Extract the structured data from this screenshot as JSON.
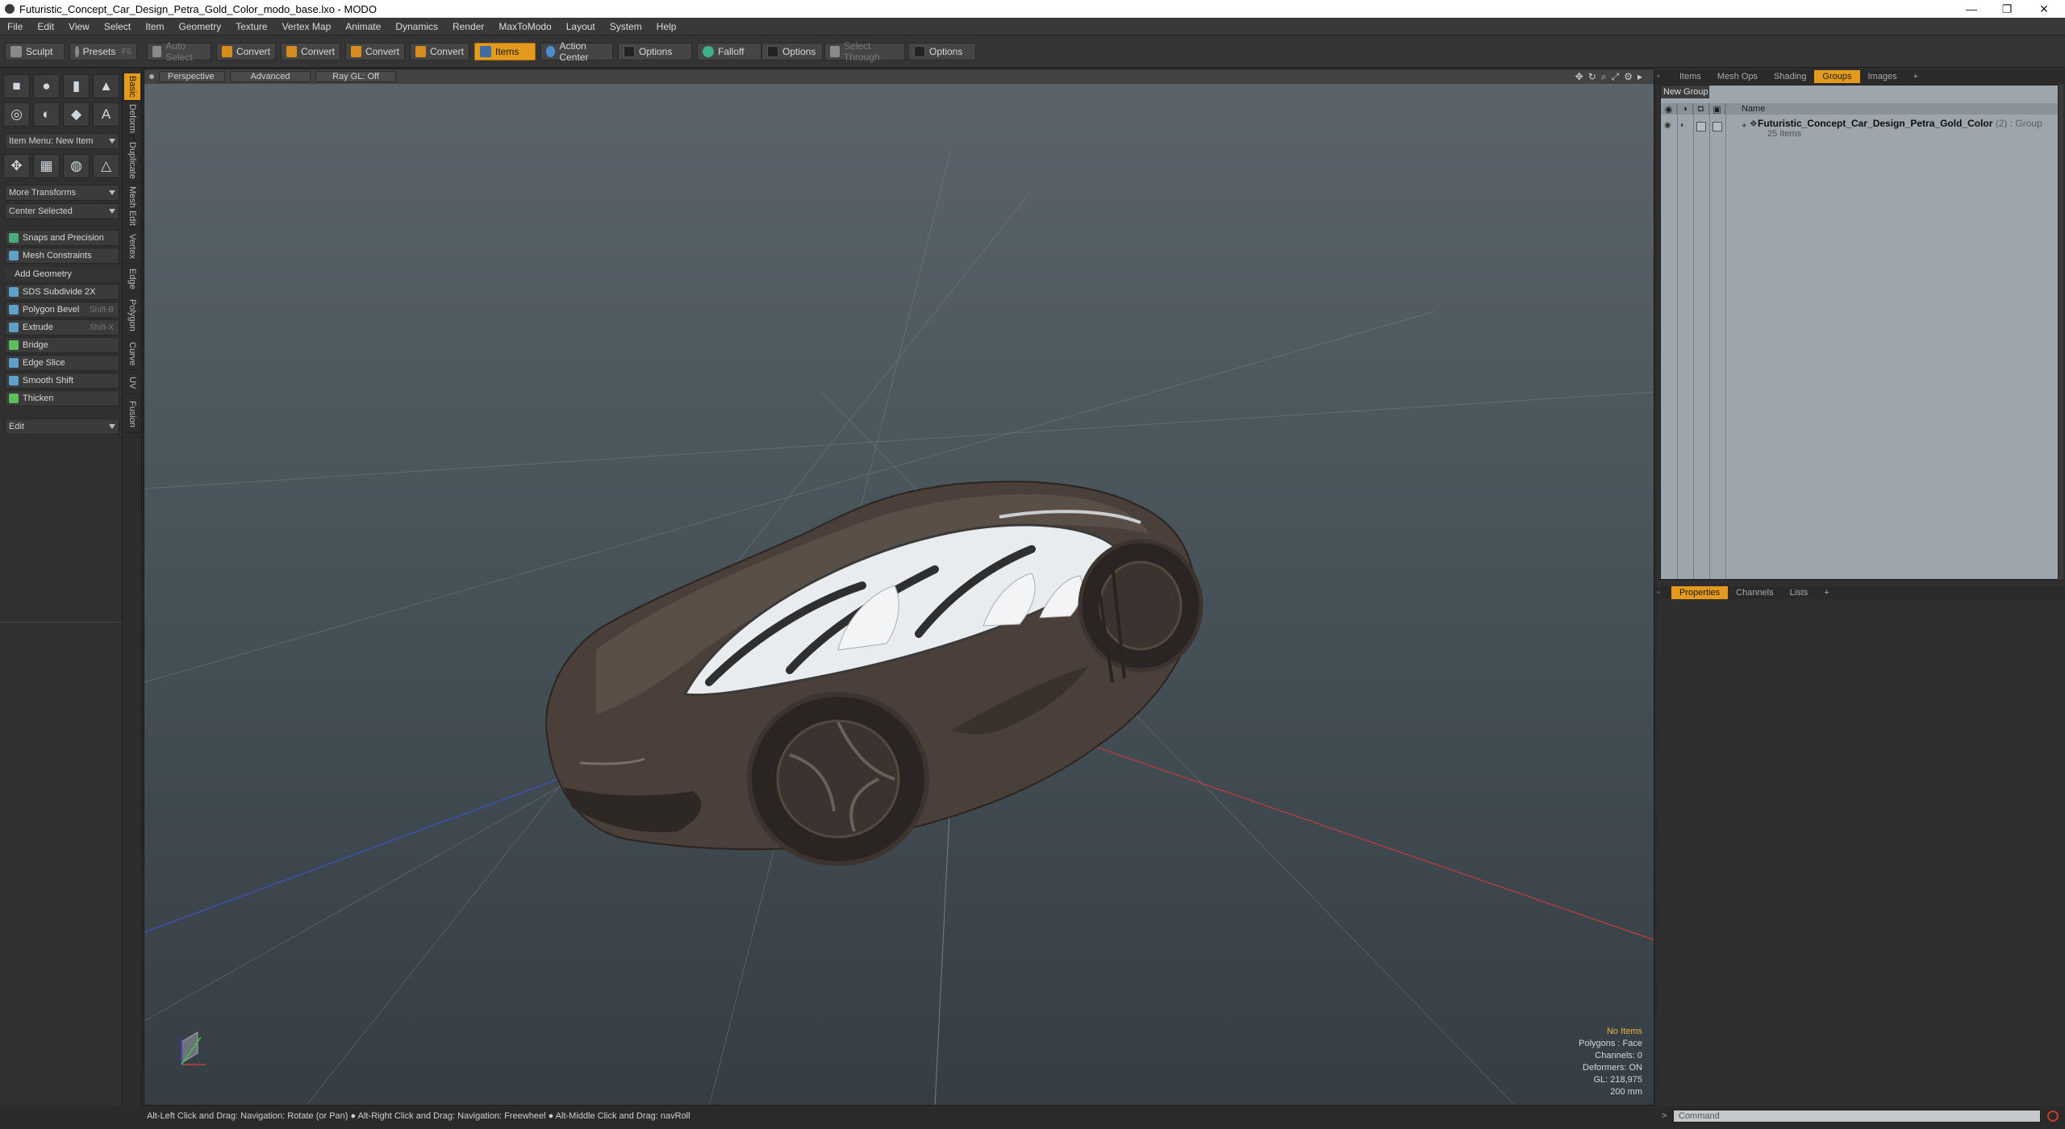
{
  "window": {
    "title": "Futuristic_Concept_Car_Design_Petra_Gold_Color_modo_base.lxo - MODO",
    "controls": [
      "—",
      "❐",
      "✕"
    ]
  },
  "menu": [
    "File",
    "Edit",
    "View",
    "Select",
    "Item",
    "Geometry",
    "Texture",
    "Vertex Map",
    "Animate",
    "Dynamics",
    "Render",
    "MaxToModo",
    "Layout",
    "System",
    "Help"
  ],
  "toolbar": {
    "sculpt": "Sculpt",
    "presets": "Presets",
    "presets_key": "F6",
    "auto_select": "Auto Select",
    "convert1": "Convert",
    "convert2": "Convert",
    "convert3": "Convert",
    "convert4": "Convert",
    "items": "Items",
    "action_center": "Action Center",
    "options1": "Options",
    "falloff": "Falloff",
    "options2": "Options",
    "select_through": "Select Through",
    "options3": "Options"
  },
  "left": {
    "item_menu": "Item Menu: New Item",
    "more_transforms": "More Transforms",
    "center_selected": "Center Selected",
    "snaps": "Snaps and Precision",
    "mesh_constraints": "Mesh Constraints",
    "add_geometry": "Add Geometry",
    "tools": [
      {
        "label": "SDS Subdivide 2X",
        "key": ""
      },
      {
        "label": "Polygon Bevel",
        "key": "Shift-B"
      },
      {
        "label": "Extrude",
        "key": "Shift-X"
      },
      {
        "label": "Bridge",
        "key": ""
      },
      {
        "label": "Edge Slice",
        "key": ""
      },
      {
        "label": "Smooth Shift",
        "key": ""
      },
      {
        "label": "Thicken",
        "key": ""
      }
    ],
    "edit": "Edit",
    "vtabs": [
      "Basic",
      "Deform",
      "Duplicate",
      "Mesh Edit",
      "Vertex",
      "Edge",
      "Polygon",
      "Curve",
      "UV",
      "Fusion"
    ]
  },
  "viewport": {
    "perspective": "Perspective",
    "advanced": "Advanced",
    "raygl": "Ray GL: Off",
    "stats": [
      "No Items",
      "Polygons : Face",
      "Channels: 0",
      "Deformers: ON",
      "GL: 218,975",
      "200 mm"
    ]
  },
  "right": {
    "tabs": [
      "Items",
      "Mesh Ops",
      "Shading",
      "Groups",
      "Images",
      "+"
    ],
    "active_tab": "Groups",
    "new_group": "New Group",
    "name_header": "Name",
    "group_name": "Futuristic_Concept_Car_Design_Petra_Gold_Color",
    "group_suffix": "(2) : Group",
    "group_count": "25 Items",
    "bottom_tabs": [
      "Properties",
      "Channels",
      "Lists",
      "+"
    ]
  },
  "status": {
    "hint": "Alt-Left Click and Drag: Navigation: Rotate (or Pan) ● Alt-Right Click and Drag: Navigation: Freewheel ● Alt-Middle Click and Drag: navRoll"
  },
  "command": {
    "placeholder": "Command"
  },
  "colors": {
    "accent": "#e49a1c",
    "car_body": "#4a3f39"
  }
}
